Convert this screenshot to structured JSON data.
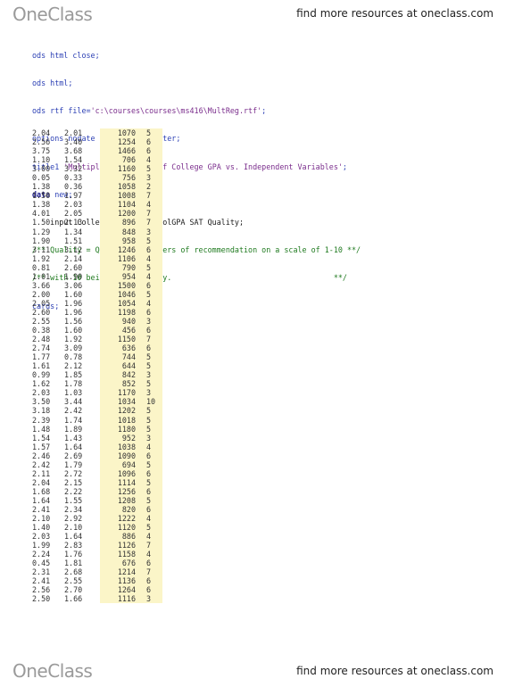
{
  "header": {
    "logo": "OneClass",
    "tagline": "find more resources at oneclass.com"
  },
  "footer": {
    "logo": "OneClass",
    "tagline": "find more resources at oneclass.com"
  },
  "code": {
    "l1": "ods html close;",
    "l2": "ods html;",
    "l3_pre": "ods rtf file=",
    "l3_str": "'c:\\courses\\courses\\ms416\\MultReg.rtf'",
    "l3_post": ";",
    "l4": "options nodate nonumber nocenter;",
    "l5_pre": "title1 ",
    "l5_str": "'Multiple Regression of College GPA vs. Independent Variables'",
    "l5_post": ";",
    "l6_kw": "data",
    "l6_rest": " new;",
    "l7": "    input CollegeGPA HighSchoolGPA SAT Quality;",
    "l8": "/** Quality = Quality of letters of recommendation on a scale of 1-10 **/",
    "l9": "/** with 10 being high quality.                                    **/",
    "l10": "cards;"
  },
  "rows": [
    [
      "2.04",
      "2.01",
      "1070",
      "5"
    ],
    [
      "2.56",
      "3.40",
      "1254",
      "6"
    ],
    [
      "3.75",
      "3.68",
      "1466",
      "6"
    ],
    [
      "1.10",
      "1.54",
      "706",
      "4"
    ],
    [
      "3.00",
      "3.32",
      "1160",
      "5"
    ],
    [
      "0.05",
      "0.33",
      "756",
      "3"
    ],
    [
      "1.38",
      "0.36",
      "1058",
      "2"
    ],
    [
      "1.50",
      "1.97",
      "1008",
      "7"
    ],
    [
      "1.38",
      "2.03",
      "1104",
      "4"
    ],
    [
      "4.01",
      "2.05",
      "1200",
      "7"
    ],
    [
      "1.50",
      "2.13",
      "896",
      "7"
    ],
    [
      "1.29",
      "1.34",
      "848",
      "3"
    ],
    [
      "1.90",
      "1.51",
      "958",
      "5"
    ],
    [
      "3.11",
      "3.12",
      "1246",
      "6"
    ],
    [
      "1.92",
      "2.14",
      "1106",
      "4"
    ],
    [
      "0.81",
      "2.60",
      "790",
      "5"
    ],
    [
      "1.01",
      "1.90",
      "954",
      "4"
    ],
    [
      "3.66",
      "3.06",
      "1500",
      "6"
    ],
    [
      "2.00",
      "1.60",
      "1046",
      "5"
    ],
    [
      "2.05",
      "1.96",
      "1054",
      "4"
    ],
    [
      "2.60",
      "1.96",
      "1198",
      "6"
    ],
    [
      "2.55",
      "1.56",
      "940",
      "3"
    ],
    [
      "0.38",
      "1.60",
      "456",
      "6"
    ],
    [
      "2.48",
      "1.92",
      "1150",
      "7"
    ],
    [
      "2.74",
      "3.09",
      "636",
      "6"
    ],
    [
      "1.77",
      "0.78",
      "744",
      "5"
    ],
    [
      "1.61",
      "2.12",
      "644",
      "5"
    ],
    [
      "0.99",
      "1.85",
      "842",
      "3"
    ],
    [
      "1.62",
      "1.78",
      "852",
      "5"
    ],
    [
      "2.03",
      "1.03",
      "1170",
      "3"
    ],
    [
      "3.50",
      "3.44",
      "1034",
      "10"
    ],
    [
      "3.18",
      "2.42",
      "1202",
      "5"
    ],
    [
      "2.39",
      "1.74",
      "1018",
      "5"
    ],
    [
      "1.48",
      "1.89",
      "1180",
      "5"
    ],
    [
      "1.54",
      "1.43",
      "952",
      "3"
    ],
    [
      "1.57",
      "1.64",
      "1038",
      "4"
    ],
    [
      "2.46",
      "2.69",
      "1090",
      "6"
    ],
    [
      "2.42",
      "1.79",
      "694",
      "5"
    ],
    [
      "2.11",
      "2.72",
      "1096",
      "6"
    ],
    [
      "2.04",
      "2.15",
      "1114",
      "5"
    ],
    [
      "1.68",
      "2.22",
      "1256",
      "6"
    ],
    [
      "1.64",
      "1.55",
      "1208",
      "5"
    ],
    [
      "2.41",
      "2.34",
      "820",
      "6"
    ],
    [
      "2.10",
      "2.92",
      "1222",
      "4"
    ],
    [
      "1.40",
      "2.10",
      "1120",
      "5"
    ],
    [
      "2.03",
      "1.64",
      "886",
      "4"
    ],
    [
      "1.99",
      "2.83",
      "1126",
      "7"
    ],
    [
      "2.24",
      "1.76",
      "1158",
      "4"
    ],
    [
      "0.45",
      "1.81",
      "676",
      "6"
    ],
    [
      "2.31",
      "2.68",
      "1214",
      "7"
    ],
    [
      "2.41",
      "2.55",
      "1136",
      "6"
    ],
    [
      "2.56",
      "2.70",
      "1264",
      "6"
    ],
    [
      "2.50",
      "1.66",
      "1116",
      "3"
    ]
  ]
}
